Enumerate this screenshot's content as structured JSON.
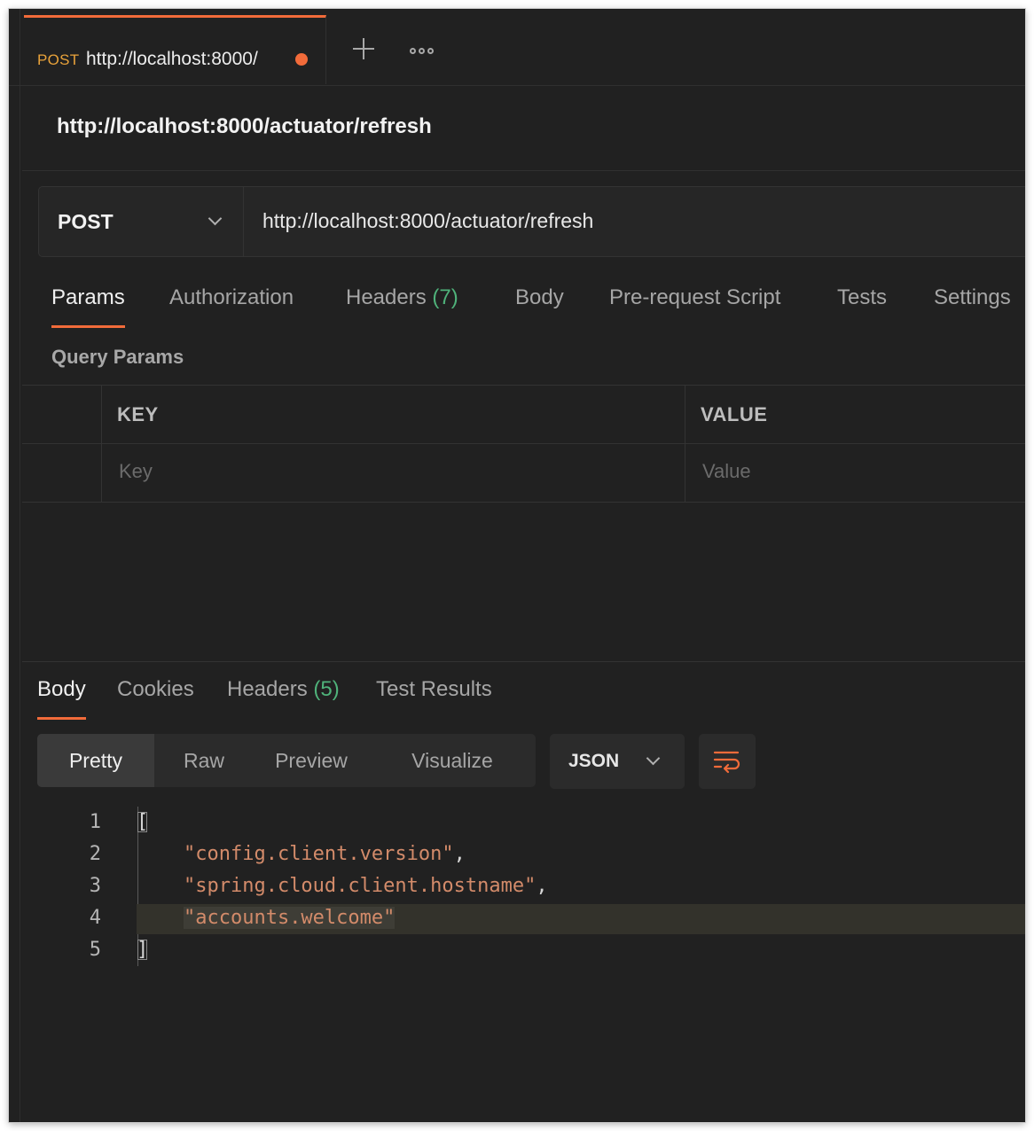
{
  "tab": {
    "method": "POST",
    "url": "http://localhost:8000/"
  },
  "request": {
    "title": "http://localhost:8000/actuator/refresh",
    "method": "POST",
    "url": "http://localhost:8000/actuator/refresh"
  },
  "request_tabs": [
    {
      "label": "Params"
    },
    {
      "label": "Authorization"
    },
    {
      "label": "Headers",
      "count": "(7)"
    },
    {
      "label": "Body"
    },
    {
      "label": "Pre-request Script"
    },
    {
      "label": "Tests"
    },
    {
      "label": "Settings"
    }
  ],
  "query_params": {
    "section_label": "Query Params",
    "key_header": "KEY",
    "value_header": "VALUE",
    "key_placeholder": "Key",
    "value_placeholder": "Value"
  },
  "response_tabs": [
    {
      "label": "Body"
    },
    {
      "label": "Cookies"
    },
    {
      "label": "Headers",
      "count": "(5)"
    },
    {
      "label": "Test Results"
    }
  ],
  "view_modes": [
    "Pretty",
    "Raw",
    "Preview",
    "Visualize"
  ],
  "format": "JSON",
  "code_lines": [
    {
      "num": "1",
      "open": "["
    },
    {
      "num": "2",
      "value": "\"config.client.version\"",
      "comma": ","
    },
    {
      "num": "3",
      "value": "\"spring.cloud.client.hostname\"",
      "comma": ","
    },
    {
      "num": "4",
      "value": "\"accounts.welcome\""
    },
    {
      "num": "5",
      "close": "]"
    }
  ],
  "colors": {
    "accent": "#f26b3a",
    "method_tab": "#e8a23a",
    "count_green": "#4fb27a",
    "string": "#d38b6a",
    "background": "#212121"
  },
  "icons": [
    "plus-icon",
    "more-options-icon",
    "chevron-down-icon",
    "wrap-lines-icon"
  ]
}
